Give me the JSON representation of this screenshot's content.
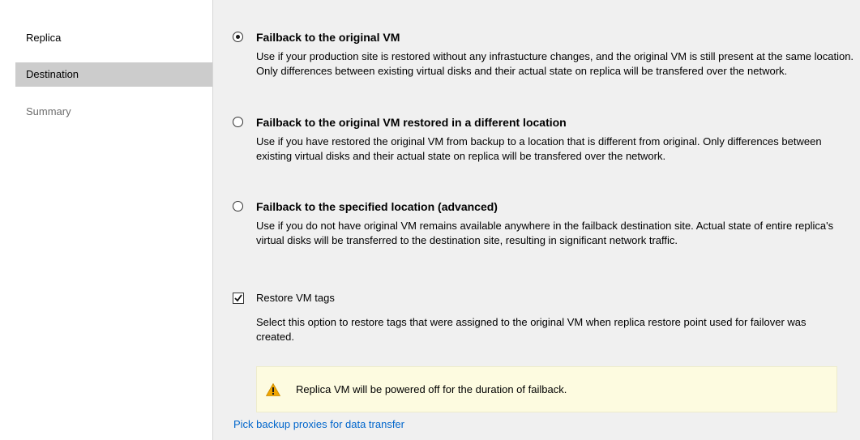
{
  "nav": {
    "items": [
      {
        "label": "Replica",
        "state": "normal"
      },
      {
        "label": "Destination",
        "state": "selected"
      },
      {
        "label": "Summary",
        "state": "disabled"
      }
    ]
  },
  "options": [
    {
      "title": "Failback to the original VM",
      "checked": true,
      "description": "Use if your production site is restored without any infrastucture changes, and the original VM is still present at the same location.  Only differences between existing virtual disks and their actual state on replica will be transfered over the network."
    },
    {
      "title": "Failback to the original VM restored in a different location",
      "checked": false,
      "description": "Use if you have restored the original VM from backup to a location that is different from original. Only differences between existing virtual disks and their actual state on replica will be transfered over the network."
    },
    {
      "title": "Failback to the specified location (advanced)",
      "checked": false,
      "description": "Use if you do not have original VM remains available anywhere in the failback destination site. Actual state of entire replica's virtual disks will be transferred to the destination site, resulting in significant network traffic."
    }
  ],
  "restore_tags": {
    "label": "Restore VM tags",
    "checked": true,
    "description": "Select this option to restore tags that were assigned to the original VM when replica restore point used for failover was created."
  },
  "warning": {
    "icon": "warning-triangle-icon",
    "text": "Replica VM will be powered off for the duration of failback."
  },
  "link": {
    "text": "Pick backup proxies for data transfer"
  },
  "colors": {
    "nav_selected_bg": "#cccccc",
    "link": "#0066cc",
    "warning_bg": "#fdfbe0",
    "warning_icon": "#f0a500"
  }
}
